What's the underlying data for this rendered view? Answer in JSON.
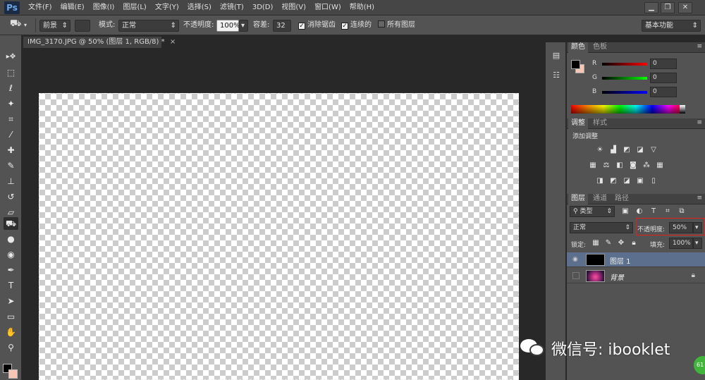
{
  "app": {
    "logo": "Ps",
    "menu": [
      "文件(F)",
      "编辑(E)",
      "图像(I)",
      "图层(L)",
      "文字(Y)",
      "选择(S)",
      "滤镜(T)",
      "3D(D)",
      "视图(V)",
      "窗口(W)",
      "帮助(H)"
    ],
    "window_controls": [
      "▁",
      "❐",
      "✕"
    ]
  },
  "options": {
    "fill_source": "前景",
    "mode_label": "模式:",
    "mode_value": "正常",
    "opacity_label": "不透明度:",
    "opacity_value": "100%",
    "tolerance_label": "容差:",
    "tolerance_value": "32",
    "antialias_label": "消除锯齿",
    "contiguous_label": "连续的",
    "all_layers_label": "所有图层",
    "workspace": "基本功能"
  },
  "document": {
    "tab_title": "IMG_3170.JPG @ 50% (图层 1, RGB/8) *"
  },
  "color_panel": {
    "tabs": [
      "颜色",
      "色板"
    ],
    "channels": [
      {
        "label": "R",
        "value": "0"
      },
      {
        "label": "G",
        "value": "0"
      },
      {
        "label": "B",
        "value": "0"
      }
    ],
    "foreground": "#000000",
    "background": "#f4c6b3"
  },
  "adjust_panel": {
    "tabs": [
      "调整",
      "样式"
    ],
    "title": "添加调整"
  },
  "layers_panel": {
    "tabs": [
      "图层",
      "通道",
      "路径"
    ],
    "filter_value": "类型",
    "blend_mode": "正常",
    "opacity_label": "不透明度:",
    "opacity_value": "50%",
    "lock_label": "锁定:",
    "fill_label": "填充:",
    "fill_value": "100%",
    "layers": [
      {
        "name": "图层 1",
        "selected": true,
        "visible": true
      },
      {
        "name": "背景",
        "selected": false,
        "visible": false,
        "locked": true
      }
    ]
  },
  "watermark": {
    "text": "微信号: ibooklet",
    "badge": "61"
  },
  "colors": {
    "highlight": "#e0201c",
    "selected_layer": "#5c6f8c",
    "canvas_dark": "#282828"
  }
}
